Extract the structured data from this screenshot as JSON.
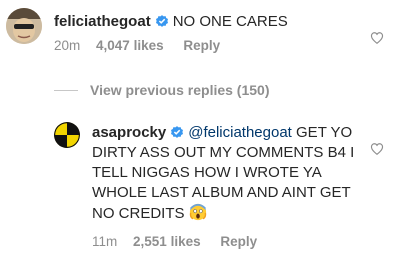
{
  "comment1": {
    "username": "feliciathegoat",
    "text": "NO ONE CARES",
    "time": "20m",
    "likes": "4,047 likes",
    "reply": "Reply"
  },
  "previous_replies": "View previous replies (150)",
  "comment2": {
    "username": "asaprocky",
    "mention": "@feliciathegoat",
    "text": "GET YO DIRTY ASS OUT MY COMMENTS B4 I TELL NIGGAS HOW I WROTE YA WHOLE LAST ALBUM AND AINT GET NO CREDITS",
    "time": "11m",
    "likes": "2,551 likes",
    "reply": "Reply"
  },
  "colors": {
    "verified": "#3897f0",
    "meta": "#8e8e8e",
    "mention": "#00376b"
  },
  "icons": [
    "verified-badge-icon",
    "heart-icon",
    "scream-emoji-icon"
  ]
}
